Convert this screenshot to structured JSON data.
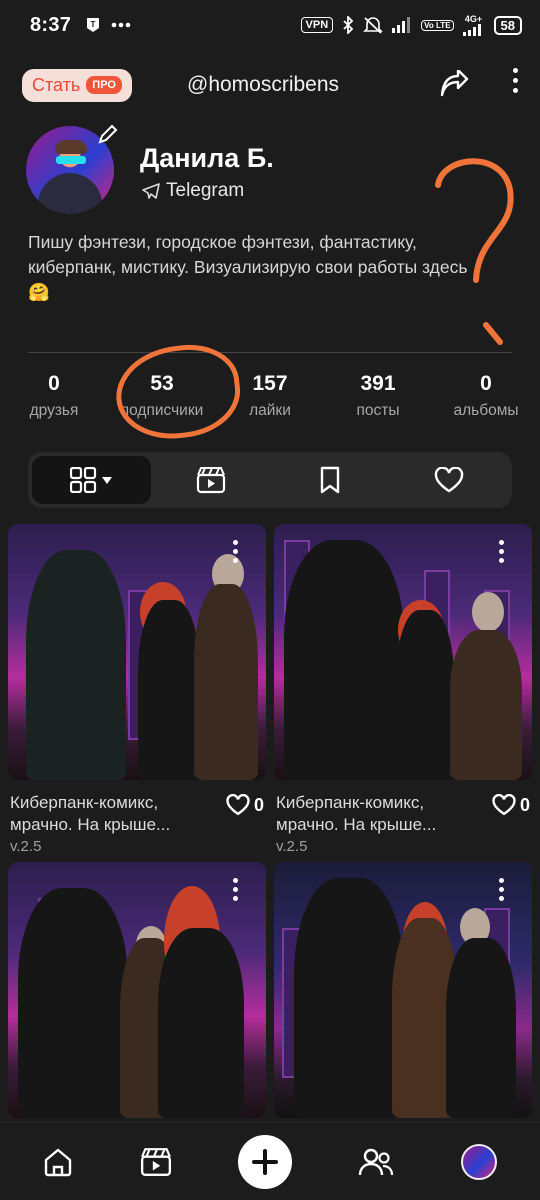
{
  "status_bar": {
    "time": "8:37",
    "vpn": "VPN",
    "network": "4G+",
    "volte": "Vo LTE",
    "battery": "58"
  },
  "header": {
    "become_label": "Стать",
    "pro_badge": "ПРО",
    "handle": "@homoscribens",
    "share_icon": "share-icon",
    "menu_icon": "more-vert-icon"
  },
  "profile": {
    "name": "Данила Б.",
    "link_label": "Telegram",
    "bio": "Пишу фэнтези, городское фэнтези, фантастику, киберпанк, мистику. Визуализирую свои работы здесь 🤗"
  },
  "stats": [
    {
      "value": "0",
      "label": "друзья"
    },
    {
      "value": "53",
      "label": "подписчики"
    },
    {
      "value": "157",
      "label": "лайки"
    },
    {
      "value": "391",
      "label": "посты"
    },
    {
      "value": "0",
      "label": "альбомы"
    }
  ],
  "tabs": [
    {
      "icon": "grid-icon",
      "active": true
    },
    {
      "icon": "clapperboard-icon",
      "active": false
    },
    {
      "icon": "bookmark-icon",
      "active": false
    },
    {
      "icon": "heart-icon",
      "active": false
    }
  ],
  "posts": [
    {
      "title": "Киберпанк-комикс, мрачно. На крыше...",
      "version": "v.2.5",
      "likes": "0"
    },
    {
      "title": "Киберпанк-комикс, мрачно. На крыше...",
      "version": "v.2.5",
      "likes": "0"
    },
    {
      "title": "",
      "version": "",
      "likes": ""
    },
    {
      "title": "",
      "version": "",
      "likes": ""
    }
  ],
  "nav": [
    "home-icon",
    "clapperboard-icon",
    "plus-icon",
    "people-icon",
    "avatar"
  ],
  "colors": {
    "background": "#1c1c1c",
    "pro_accent": "#f0553a",
    "annotation": "#f0743a"
  }
}
